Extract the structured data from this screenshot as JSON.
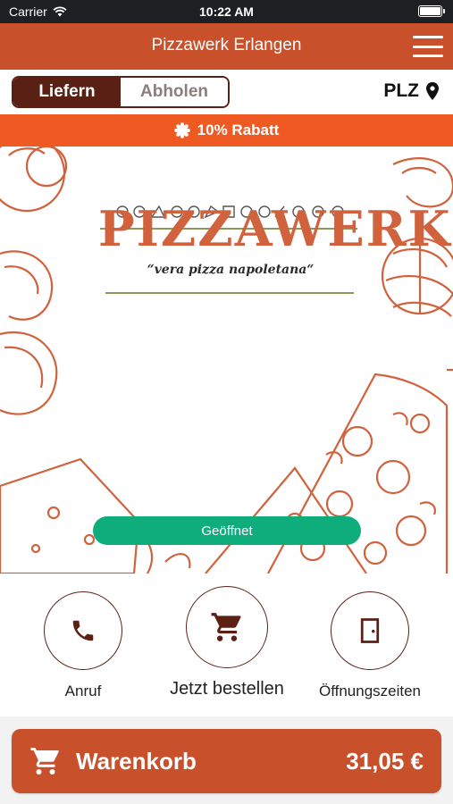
{
  "status_bar": {
    "carrier": "Carrier",
    "time": "10:22 AM"
  },
  "nav": {
    "title": "Pizzawerk Erlangen"
  },
  "mode": {
    "delivery_label": "Liefern",
    "pickup_label": "Abholen",
    "selected": "Liefern",
    "plz_label": "PLZ"
  },
  "promo": {
    "text": "10% Rabatt"
  },
  "hero": {
    "logo_text": "PIZZAWERK",
    "tagline": "“vera pizza napoletana“",
    "status": "Geöffnet"
  },
  "actions": {
    "call_label": "Anruf",
    "order_label": "Jetzt bestellen",
    "hours_label": "Öffnungszeiten"
  },
  "cart": {
    "label": "Warenkorb",
    "total": "31,05 €"
  },
  "colors": {
    "brand": "#c8502a",
    "promo": "#ee5a22",
    "dark": "#5b2014",
    "open_status": "#10ad7c"
  },
  "icons": [
    "wifi-icon",
    "battery-icon",
    "menu-icon",
    "location-pin-icon",
    "badge-icon",
    "phone-icon",
    "cart-icon",
    "door-icon"
  ]
}
